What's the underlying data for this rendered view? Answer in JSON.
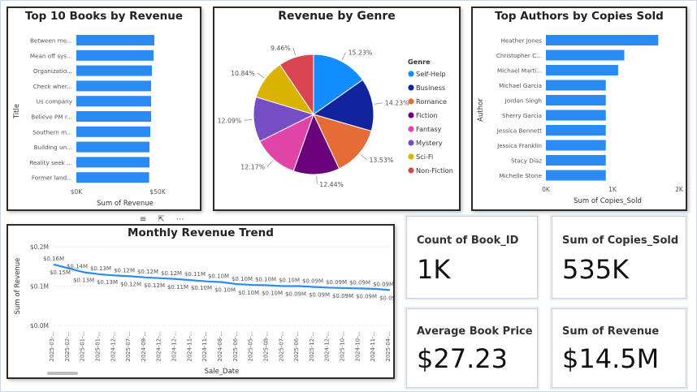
{
  "colors": {
    "bar": "#2a8cf2",
    "line": "#2a8cf2",
    "grid": "#e1e1e1"
  },
  "visual_header_icons": [
    "filter-icon",
    "focus-mode-icon",
    "more-options-icon"
  ],
  "books_chart": {
    "title": "Top 10 Books by Revenue",
    "xlabel": "Sum of Revenue",
    "ylabel": "Title"
  },
  "genre_chart": {
    "title": "Revenue by Genre",
    "legend_title": "Genre"
  },
  "authors_chart": {
    "title": "Top Authors by Copies Sold",
    "xlabel": "Sum of Copies_Sold",
    "ylabel": "Author"
  },
  "trend_chart": {
    "title": "Monthly Revenue Trend",
    "xlabel": "Sale_Date",
    "ylabel": "Sum of Revenue"
  },
  "cards": [
    {
      "label": "Count of Book_ID",
      "value": "1K"
    },
    {
      "label": "Sum of Copies_Sold",
      "value": "535K"
    },
    {
      "label": "Average Book Price",
      "value": "$27.23"
    },
    {
      "label": "Sum of Revenue",
      "value": "$14.5M"
    }
  ],
  "chart_data": [
    {
      "type": "bar",
      "orientation": "horizontal",
      "title": "Top 10 Books by Revenue",
      "xlabel": "Sum of Revenue",
      "ylabel": "Title",
      "categories": [
        "Between me...",
        "Mean off sys...",
        "Organizatio...",
        "Check wher...",
        "Us company",
        "Believe PM r...",
        "Southern m...",
        "Building un...",
        "Reality seek ...",
        "Former land..."
      ],
      "values": [
        48000,
        47500,
        46500,
        46000,
        46000,
        46000,
        45500,
        45000,
        45000,
        44800
      ],
      "xlim": [
        0,
        60000
      ],
      "xticks": [
        "$0K",
        "$50K"
      ],
      "grid": false
    },
    {
      "type": "pie",
      "title": "Revenue by Genre",
      "legend_title": "Genre",
      "legend_position": "right",
      "categories": [
        "Self-Help",
        "Business",
        "Romance",
        "Fiction",
        "Fantasy",
        "Mystery",
        "Sci-Fi",
        "Non-Fiction"
      ],
      "values": [
        15.23,
        14.23,
        13.53,
        12.44,
        12.17,
        12.09,
        10.84,
        9.46
      ],
      "labels": [
        "15.23%",
        "14.23%",
        "13.53%",
        "12.44%",
        "12.17%",
        "12.09%",
        "10.84%",
        "9.46%"
      ],
      "colors": [
        "#118dff",
        "#12239e",
        "#e66c37",
        "#6b007b",
        "#e044a7",
        "#744ec2",
        "#d9b300",
        "#d64550"
      ]
    },
    {
      "type": "bar",
      "orientation": "horizontal",
      "title": "Top Authors by Copies Sold",
      "xlabel": "Sum of Copies_Sold",
      "ylabel": "Author",
      "categories": [
        "Heather Jones",
        "Christopher C...",
        "Michael Marti...",
        "Michael Garcia",
        "Jordan Singh",
        "Sherry Garcia",
        "Jessica Bennett",
        "Jessica Franklin",
        "Stacy Diaz",
        "Michelle Stone"
      ],
      "values": [
        1820,
        1270,
        1170,
        970,
        970,
        970,
        970,
        970,
        970,
        970
      ],
      "xlim": [
        0,
        2000
      ],
      "xticks": [
        "0K",
        "1K",
        "2K"
      ],
      "grid": false
    },
    {
      "type": "line",
      "title": "Monthly Revenue Trend",
      "xlabel": "Sale_Date",
      "ylabel": "Sum of Revenue",
      "x": [
        "2025-03-...",
        "2025-02-...",
        "2025-01-...",
        "2025-01-...",
        "2024-12-...",
        "2025-07-...",
        "2024-09-...",
        "2024-12-...",
        "2024-12-...",
        "2024-11-...",
        "2024-11-...",
        "2024-08-...",
        "2025-06-...",
        "2025-05-...",
        "2025-08-...",
        "2025-07-...",
        "2025-06-...",
        "2025-12-...",
        "2024-12-...",
        "2025-10-...",
        "2024-10-...",
        "2024-11-...",
        "2025-04-..."
      ],
      "values": [
        0.155,
        0.145,
        0.135,
        0.13,
        0.127,
        0.125,
        0.122,
        0.12,
        0.118,
        0.115,
        0.112,
        0.11,
        0.105,
        0.103,
        0.102,
        0.1,
        0.1,
        0.098,
        0.096,
        0.095,
        0.094,
        0.093,
        0.09
      ],
      "point_labels_above": [
        "$0.16M",
        "$0.14M",
        "$0.13M",
        "$0.12M",
        "$0.12M",
        "$0.12M",
        "$0.11M",
        "$0.10M",
        "$0.10M",
        "$0.10M",
        "$0.10M",
        "$0.09M",
        "$0.09M",
        "$0.09M",
        "$0.09M"
      ],
      "point_labels_below": [
        "$0.15M",
        "$0.13M",
        "$0.13M",
        "$0.12M",
        "$0.12M",
        "$0.11M",
        "$0.10M",
        "$0.10M",
        "$0.10M",
        "$0.10M",
        "$0.09M",
        "$0.09M",
        "$0.09M",
        "$0.09M",
        "$0.09M"
      ],
      "yticks": [
        "$0.0M",
        "$0.1M",
        "$0.2M"
      ],
      "ylim": [
        0,
        0.2
      ],
      "grid": true
    }
  ]
}
